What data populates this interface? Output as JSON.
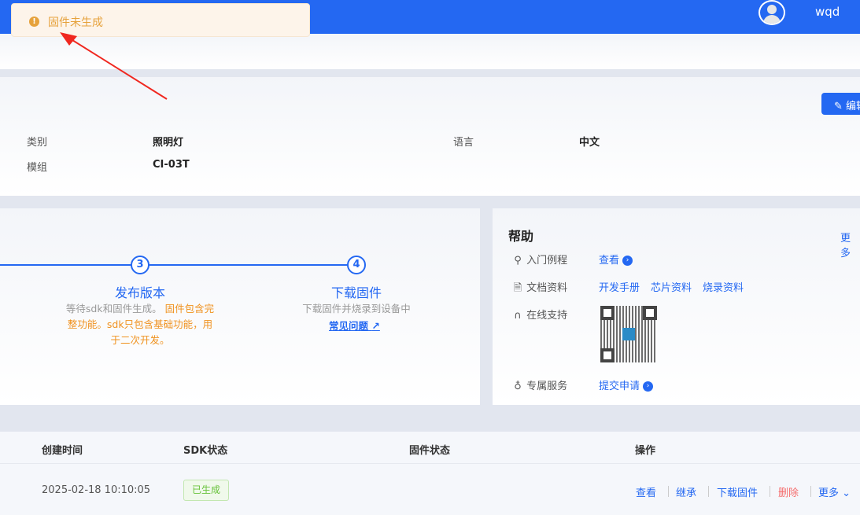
{
  "header": {
    "username": "wqd"
  },
  "toast": {
    "message": "固件未生成"
  },
  "info": {
    "edit_label": "编辑",
    "category_label": "类别",
    "category_value": "照明灯",
    "module_label": "模组",
    "module_value": "CI-03T",
    "language_label": "语言",
    "language_value": "中文"
  },
  "steps": [
    {
      "number": "3",
      "title": "发布版本",
      "desc_gray": "等待sdk和固件生成。",
      "desc_orange": "固件包含完整功能。sdk只包含基础功能，用于二次开发。"
    },
    {
      "number": "4",
      "title": "下载固件",
      "desc": "下载固件并烧录到设备中",
      "link": "常见问题"
    }
  ],
  "help": {
    "title": "帮助",
    "more": "更多",
    "rows": [
      {
        "label": "入门例程",
        "links": [
          "查看"
        ]
      },
      {
        "label": "文档资料",
        "links": [
          "开发手册",
          "芯片资料",
          "烧录资料"
        ]
      },
      {
        "label": "在线支持"
      },
      {
        "label": "专属服务",
        "links": [
          "提交申请"
        ]
      }
    ]
  },
  "table": {
    "headers": [
      "创建时间",
      "SDK状态",
      "固件状态",
      "操作"
    ],
    "rows": [
      {
        "created": "2025-02-18 10:10:05",
        "sdk_status": "已生成",
        "firmware_status": "",
        "actions": [
          "查看",
          "继承",
          "下载固件",
          "删除",
          "更多"
        ]
      }
    ]
  }
}
